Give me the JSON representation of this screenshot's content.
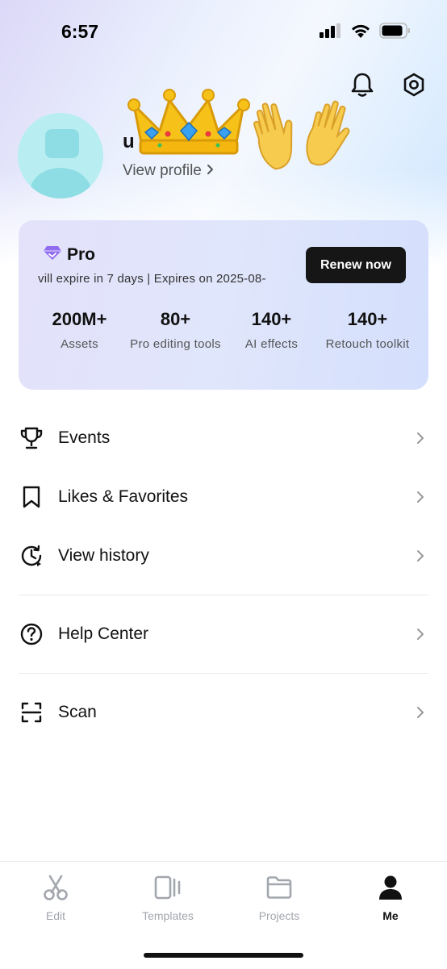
{
  "status_bar": {
    "time": "6:57",
    "icons": [
      "signal-icon",
      "wifi-icon",
      "battery-icon"
    ]
  },
  "header": {
    "actions": [
      "bell-icon",
      "settings-icon"
    ]
  },
  "profile": {
    "username": "u",
    "view_profile_label": "View profile",
    "stickers": [
      "crown-emoji",
      "waving-hands-emoji"
    ]
  },
  "pro_card": {
    "title": "Pro",
    "expire_text": "vill expire in 7 days | Expires on 2025-08-",
    "renew_label": "Renew now",
    "stats": [
      {
        "value": "200M+",
        "label": "Assets"
      },
      {
        "value": "80+",
        "label": "Pro editing tools"
      },
      {
        "value": "140+",
        "label": "AI effects"
      },
      {
        "value": "140+",
        "label": "Retouch toolkit"
      }
    ]
  },
  "menu": {
    "events": "Events",
    "likes": "Likes & Favorites",
    "history": "View history",
    "help": "Help Center",
    "scan": "Scan"
  },
  "nav": {
    "edit": "Edit",
    "templates": "Templates",
    "projects": "Projects",
    "me": "Me",
    "active": "Me"
  },
  "colors": {
    "accent_pro": "#8f6cf0",
    "avatar_bg": "#b8eef2",
    "renew_bg": "#161616",
    "nav_inactive": "#a2a6ad"
  }
}
